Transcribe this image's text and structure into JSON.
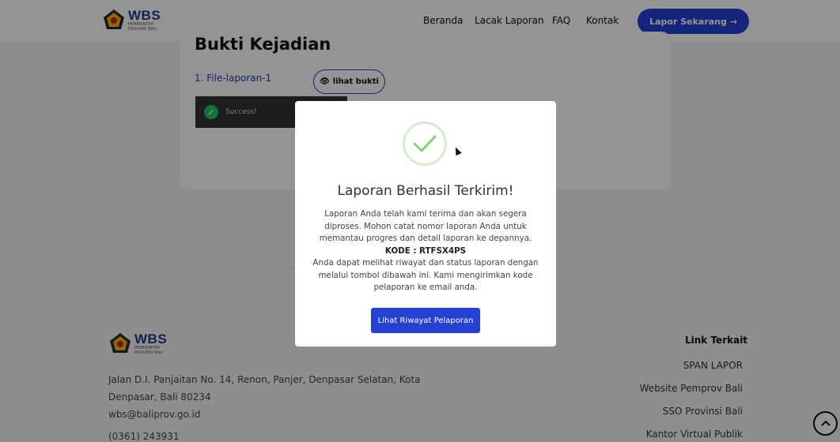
{
  "header": {
    "logo": {
      "title": "WBS",
      "subtitle_line1": "PEMERINTAH",
      "subtitle_line2": "PROVINSI BALI"
    },
    "nav": [
      "Beranda",
      "Lacak Laporan",
      "FAQ",
      "Kontak"
    ],
    "cta_label": "Lapor Sekarang →"
  },
  "background": {
    "section_heading": "Bukti Kejadian",
    "file_item": "1. File-laporan-1",
    "view_button": "lihat bukti",
    "toast_message": "Success!"
  },
  "modal": {
    "title": "Laporan Berhasil Terkirim!",
    "line1": "Laporan Anda telah kami terima dan akan segera diproses. Mohon catat nomor laporan Anda untuk memantau progres dan detail laporan ke depannya.",
    "code_label": "KODE : RTFSX4PS",
    "line2": "Anda dapat melihat riwayat dan status laporan dengan melalui tombol dibawah ini. Kami mengirimkan kode pelaporan ke email anda.",
    "button_label": "Lihat Riwayat Pelaporan"
  },
  "footer": {
    "logo": {
      "title": "WBS",
      "subtitle_line1": "PEMERINTAH",
      "subtitle_line2": "PROVINSI BALI"
    },
    "address": "Jalan D.I. Panjaitan No. 14, Renon, Panjer, Denpasar Selatan, Kota Denpasar, Bali 80234",
    "email": "wbs@baliprov.go.id",
    "phone": "(0361) 243931",
    "links_title": "Link Terkait",
    "links": [
      "SPAN LAPOR",
      "Website Pemprov Bali",
      "SSO Provinsi Bali",
      "Kantor Virtual Publik"
    ]
  },
  "colors": {
    "primary": "#2541d1",
    "success": "#22c55e",
    "success_ring": "#d6ecd1",
    "brand_text": "#1e3a8a"
  }
}
